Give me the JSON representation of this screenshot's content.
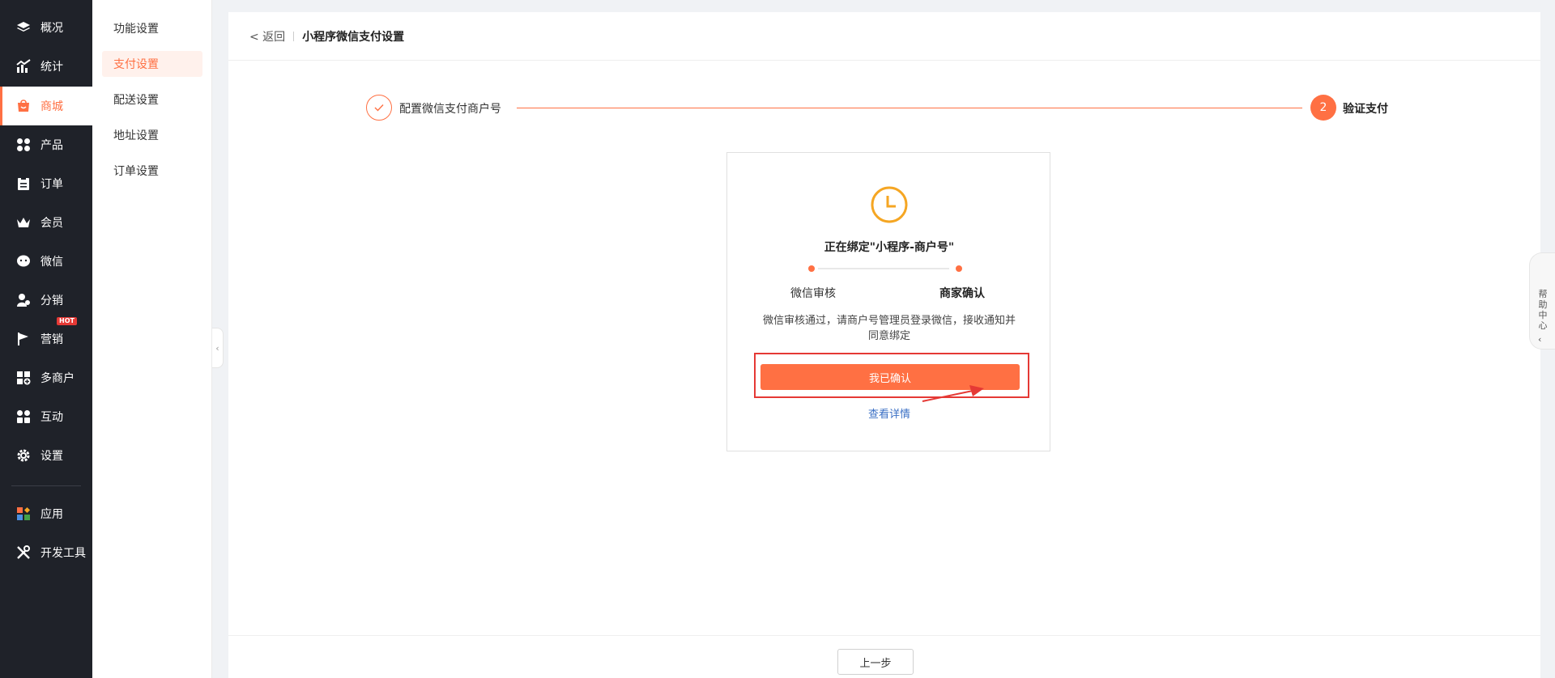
{
  "sidebar": {
    "items": [
      {
        "label": "概况",
        "icon": "layers-icon"
      },
      {
        "label": "统计",
        "icon": "chart-icon"
      },
      {
        "label": "商城",
        "icon": "shop-icon",
        "active": true
      },
      {
        "label": "产品",
        "icon": "grid-icon"
      },
      {
        "label": "订单",
        "icon": "clipboard-icon"
      },
      {
        "label": "会员",
        "icon": "crown-icon"
      },
      {
        "label": "微信",
        "icon": "wechat-icon"
      },
      {
        "label": "分销",
        "icon": "users-icon"
      },
      {
        "label": "营销",
        "icon": "flag-icon",
        "badge": "HOT"
      },
      {
        "label": "多商户",
        "icon": "store-plus-icon"
      },
      {
        "label": "互动",
        "icon": "interact-icon"
      },
      {
        "label": "设置",
        "icon": "gear-icon"
      },
      {
        "label": "应用",
        "icon": "apps-icon"
      },
      {
        "label": "开发工具",
        "icon": "tools-icon"
      }
    ]
  },
  "subnav": {
    "items": [
      {
        "label": "功能设置"
      },
      {
        "label": "支付设置",
        "active": true
      },
      {
        "label": "配送设置"
      },
      {
        "label": "地址设置"
      },
      {
        "label": "订单设置"
      }
    ]
  },
  "header": {
    "back": "< 返回",
    "title": "小程序微信支付设置"
  },
  "steps": {
    "step1_label": "配置微信支付商户号",
    "step2_number": "2",
    "step2_label": "验证支付"
  },
  "card": {
    "title": "正在绑定\"小程序-商户号\"",
    "progress_left": "微信审核",
    "progress_right": "商家确认",
    "description": "微信审核通过，请商户号管理员登录微信，接收通知并同意绑定",
    "confirm_label": "我已确认",
    "detail_link": "查看详情"
  },
  "footer": {
    "prev_label": "上一步"
  },
  "help": {
    "label": "帮助中心"
  },
  "colors": {
    "accent": "#ff7043",
    "sidebar_bg": "#1f2229",
    "highlight_red": "#e53935",
    "link_blue": "#3a6fc4",
    "clock_amber": "#f5a623"
  }
}
